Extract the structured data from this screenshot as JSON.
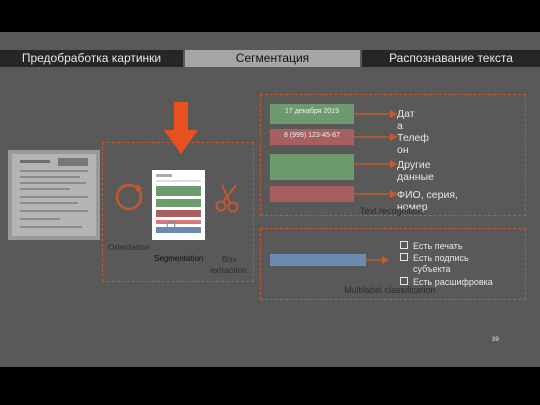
{
  "tabs": [
    {
      "label": "Предобработка картинки"
    },
    {
      "label": "Сегментация"
    },
    {
      "label": "Распознавание текста"
    }
  ],
  "labels": {
    "orientation": "Orientation",
    "segmentation": "Segmentation",
    "box_extraction_1": "Box",
    "box_extraction_2": "extraction",
    "text_recognition": "Text recognition",
    "multilabel": "Multilabel classification"
  },
  "fields": [
    {
      "snippet": "17 декабря 2019",
      "label": "Дат\nа"
    },
    {
      "snippet": "8 (999) 123-45-67",
      "label": "Телеф\nон"
    },
    {
      "snippet": "",
      "label": "Другие\nданные"
    },
    {
      "snippet": "",
      "label": "ФИО, серия,\nномер"
    }
  ],
  "checklist": [
    "Есть печать",
    "Есть подпись\nсубъекта",
    "Есть расшифровка"
  ],
  "page_number": "39",
  "colors": {
    "accent": "#e8501e",
    "dash": "#c25a2e",
    "green": "#6d9b6e",
    "red": "#a85f5f",
    "blue": "#6b88b0"
  }
}
